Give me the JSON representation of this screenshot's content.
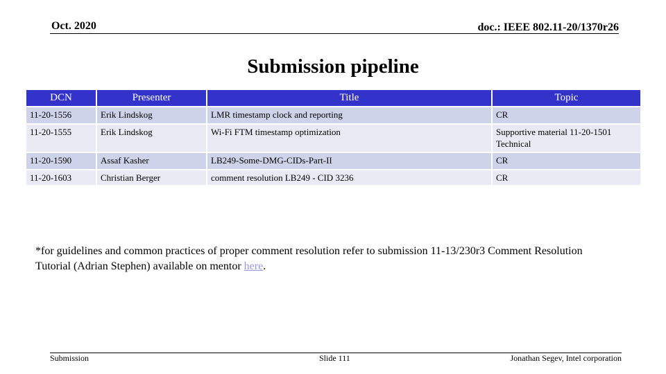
{
  "header": {
    "date": "Oct. 2020",
    "doc_id": "doc.: IEEE 802.11-20/1370r26"
  },
  "slide_title": "Submission pipeline",
  "table": {
    "columns": [
      "DCN",
      "Presenter",
      "Title",
      "Topic"
    ],
    "rows": [
      {
        "dcn": "11-20-1556",
        "presenter": "Erik Lindskog",
        "title": "LMR timestamp clock and reporting",
        "topic": "CR"
      },
      {
        "dcn": "11-20-1555",
        "presenter": "Erik Lindskog",
        "title": "Wi-Fi FTM timestamp optimization",
        "topic": "Supportive material 11-20-1501 Technical"
      },
      {
        "dcn": "11-20-1590",
        "presenter": "Assaf Kasher",
        "title": "LB249-Some-DMG-CIDs-Part-II",
        "topic": "CR"
      },
      {
        "dcn": "11-20-1603",
        "presenter": "Christian Berger",
        "title": "comment resolution LB249 - CID 3236",
        "topic": "CR"
      }
    ]
  },
  "note": {
    "text": "*for guidelines and common practices of proper comment resolution refer to submission 11-13/230r3 Comment Resolution Tutorial (Adrian Stephen) available on mentor ",
    "link_text": "here",
    "suffix": "."
  },
  "footer": {
    "left": "Submission",
    "center": "Slide 111",
    "right": "Jonathan Segev, Intel corporation"
  },
  "colors": {
    "header_fill": "#3333cc",
    "row_odd": "#cfd3ea",
    "row_even": "#e9eaf4",
    "link": "#9999dd"
  }
}
